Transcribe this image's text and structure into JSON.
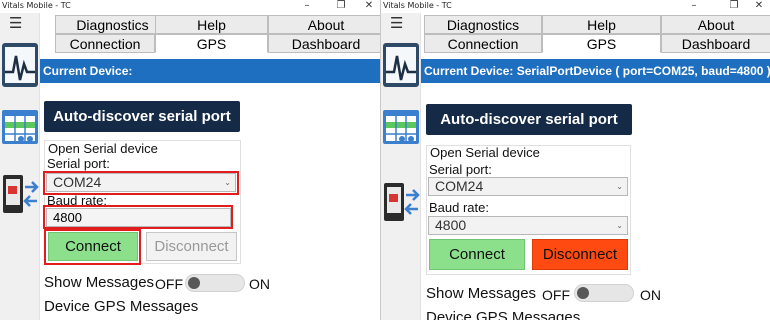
{
  "app": {
    "title": "Vitals Mobile - TC"
  },
  "window_controls": {
    "minimize": "–",
    "restore": "❐",
    "close": "✕"
  },
  "menu_icon": "☰",
  "tabs": {
    "row1": [
      "Diagnostics",
      "Help",
      "About"
    ],
    "row2": [
      "Connection",
      "GPS",
      "Dashboard"
    ],
    "selected": "GPS"
  },
  "left": {
    "current_device": "Current Device:",
    "discover_label": "Auto-discover serial port",
    "open_serial_label": "Open Serial device",
    "serial_port_label": "Serial port:",
    "serial_port_value": "COM24",
    "baud_rate_label": "Baud rate:",
    "baud_rate_value": "4800",
    "connect_label": "Connect",
    "disconnect_label": "Disconnect",
    "disconnect_enabled": false,
    "show_messages_label": "Show Messages",
    "off_label": "OFF",
    "on_label": "ON",
    "gps_messages_label": "Device GPS Messages"
  },
  "right": {
    "current_device": "Current Device: SerialPortDevice ( port=COM25, baud=4800 )",
    "discover_label": "Auto-discover serial port",
    "open_serial_label": "Open Serial device",
    "serial_port_label": "Serial port:",
    "serial_port_value": "COM24",
    "baud_rate_label": "Baud rate:",
    "baud_rate_value": "4800",
    "connect_label": "Connect",
    "disconnect_label": "Disconnect",
    "disconnect_enabled": true,
    "show_messages_label": "Show Messages",
    "off_label": "OFF",
    "on_label": "ON",
    "gps_messages_label": "Device GPS Messages"
  },
  "colors": {
    "accent_bar": "#1f6fc0",
    "discover_button": "#152a46",
    "connect_button": "#8ce08c",
    "disconnect_active": "#ff4a12",
    "highlight": "#e11d1d"
  }
}
